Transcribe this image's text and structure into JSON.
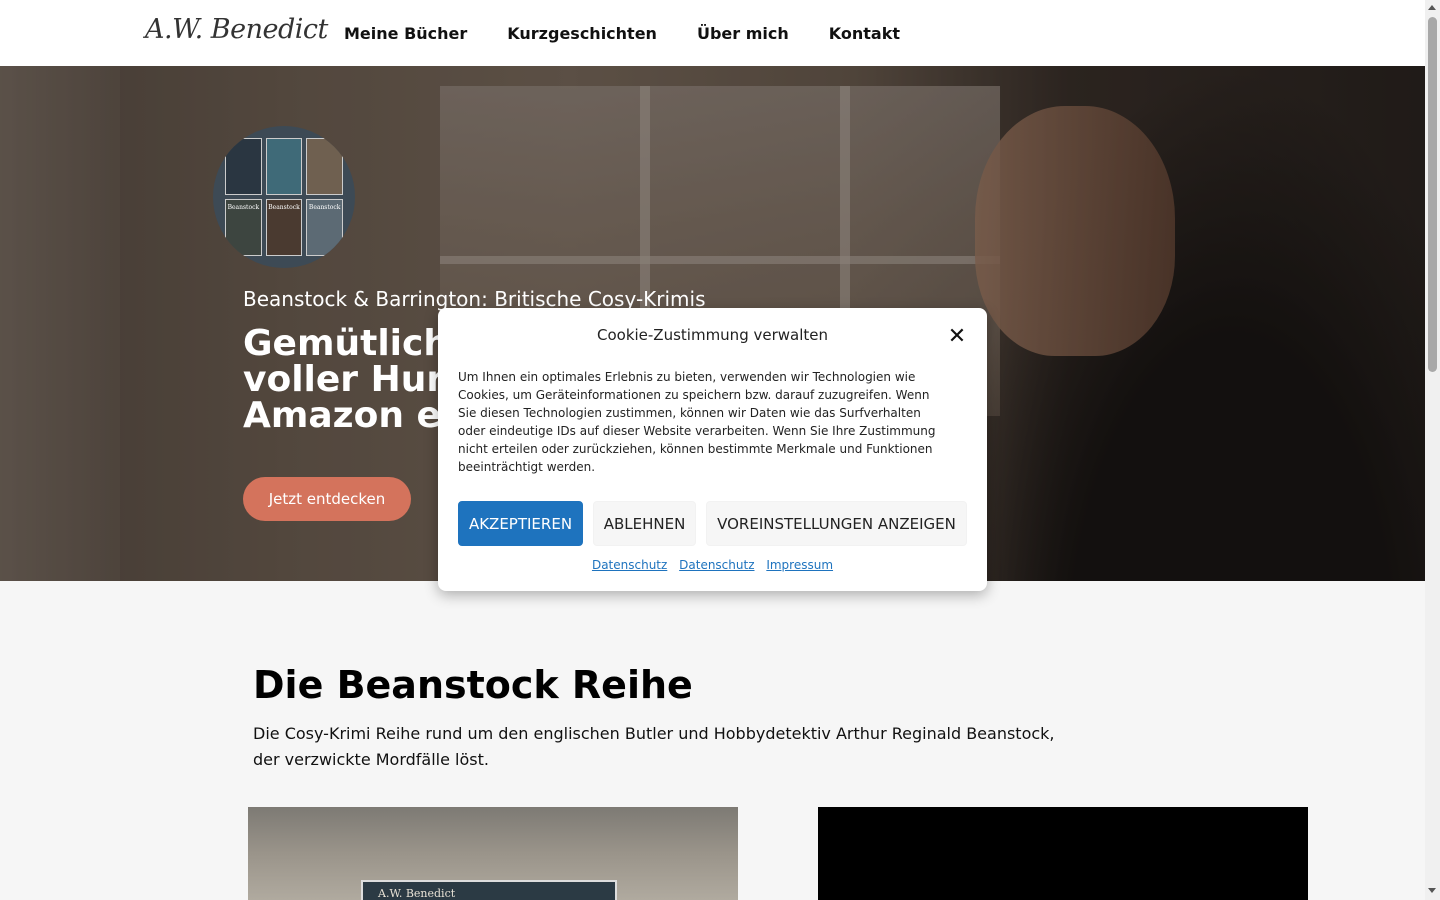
{
  "header": {
    "logo": "A.W. Benedict",
    "nav": [
      "Meine Bücher",
      "Kurzgeschichten",
      "Über mich",
      "Kontakt"
    ]
  },
  "hero": {
    "subtitle": "Beanstock & Barrington: Britische Cosy-Krimis",
    "title_line1": "Gemütlich",
    "title_line2": "voller Hur",
    "title_line3": "Amazon e",
    "button": "Jetzt entdecken",
    "book_cover_text": "Beanstock"
  },
  "section": {
    "title": "Die Beanstock Reihe",
    "description": "Die Cosy-Krimi Reihe rund um den englischen Butler und Hobbydetektiv Arthur Reginald Beanstock, der verzwickte Mordfälle löst.",
    "card_author": "A.W. Benedict"
  },
  "cookie": {
    "title": "Cookie-Zustimmung verwalten",
    "text": "Um Ihnen ein optimales Erlebnis zu bieten, verwenden wir Technologien wie Cookies, um Geräteinformationen zu speichern bzw. darauf zuzugreifen. Wenn Sie diesen Technologien zustimmen, können wir Daten wie das Surfverhalten oder eindeutige IDs auf dieser Website verarbeiten. Wenn Sie Ihre Zustimmung nicht erteilen oder zurückziehen, können bestimmte Merkmale und Funktionen beeinträchtigt werden.",
    "accept": "AKZEPTIEREN",
    "decline": "ABLEHNEN",
    "preferences": "VOREINSTELLUNGEN ANZEIGEN",
    "links": [
      "Datenschutz",
      "Datenschutz",
      "Impressum"
    ]
  },
  "colors": {
    "accent_button": "#d4735c",
    "accept_blue": "#1e73be"
  }
}
